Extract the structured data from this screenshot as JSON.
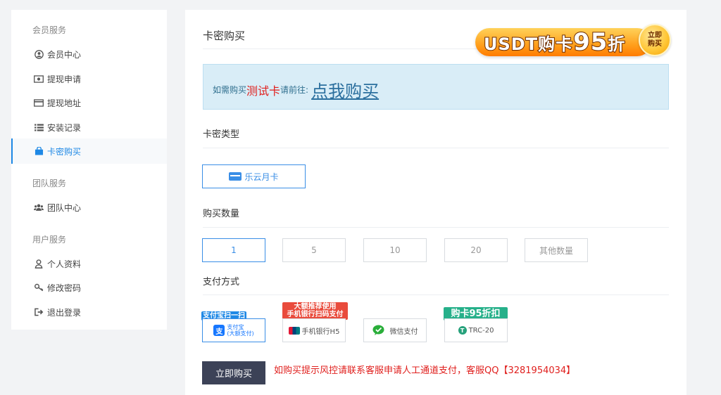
{
  "sidebar": {
    "group_member": "会员服务",
    "items_member": [
      {
        "label": "会员中心",
        "icon": "user-circle-icon"
      },
      {
        "label": "提现申请",
        "icon": "money-icon"
      },
      {
        "label": "提现地址",
        "icon": "credit-card-icon"
      },
      {
        "label": "安装记录",
        "icon": "list-icon"
      },
      {
        "label": "卡密购买",
        "icon": "shopping-bag-icon",
        "active": true
      }
    ],
    "group_team": "团队服务",
    "items_team": [
      {
        "label": "团队中心",
        "icon": "users-icon"
      }
    ],
    "group_user": "用户服务",
    "items_user": [
      {
        "label": "个人资料",
        "icon": "person-icon"
      },
      {
        "label": "修改密码",
        "icon": "key-icon"
      },
      {
        "label": "退出登录",
        "icon": "sign-out-icon"
      }
    ]
  },
  "main": {
    "title": "卡密购买",
    "promo": {
      "text_prefix": "USDT购卡",
      "text_big": "95",
      "text_suffix": "折",
      "circle_line1": "立即",
      "circle_line2": "购买"
    },
    "notice": {
      "part1": "如需购买",
      "part2": "测试卡",
      "part3": "请前往:",
      "link": "点我购买"
    },
    "card_type_label": "卡密类型",
    "card_types": [
      {
        "label": "乐云月卡",
        "selected": true
      }
    ],
    "quantity_label": "购买数量",
    "quantities": [
      {
        "label": "1",
        "selected": true
      },
      {
        "label": "5"
      },
      {
        "label": "10"
      },
      {
        "label": "20"
      },
      {
        "label": "其他数量"
      }
    ],
    "payment_label": "支付方式",
    "payments": [
      {
        "tag": "支付宝扫一扫",
        "name_line1": "支付宝",
        "name_line2": "(大额支付)",
        "icon": "alipay-icon",
        "selected": true
      },
      {
        "tag_line1": "大额推荐使用",
        "tag_line2": "手机银行扫码支付",
        "name": "手机银行H5",
        "icon": "unionpay-icon"
      },
      {
        "name": "微信支付",
        "icon": "wechat-icon"
      },
      {
        "tag": "购卡95折扣",
        "name": "TRC-20",
        "icon": "tether-icon"
      }
    ],
    "buy_button": "立即购买",
    "tip": "如购买提示风控请联系客服申请人工通道支付，客服QQ【3281954034】"
  },
  "colors": {
    "accent": "#1e88e5",
    "danger": "#e0201e",
    "notice_bg": "#d9edf7",
    "button_dark": "#3c4257"
  }
}
